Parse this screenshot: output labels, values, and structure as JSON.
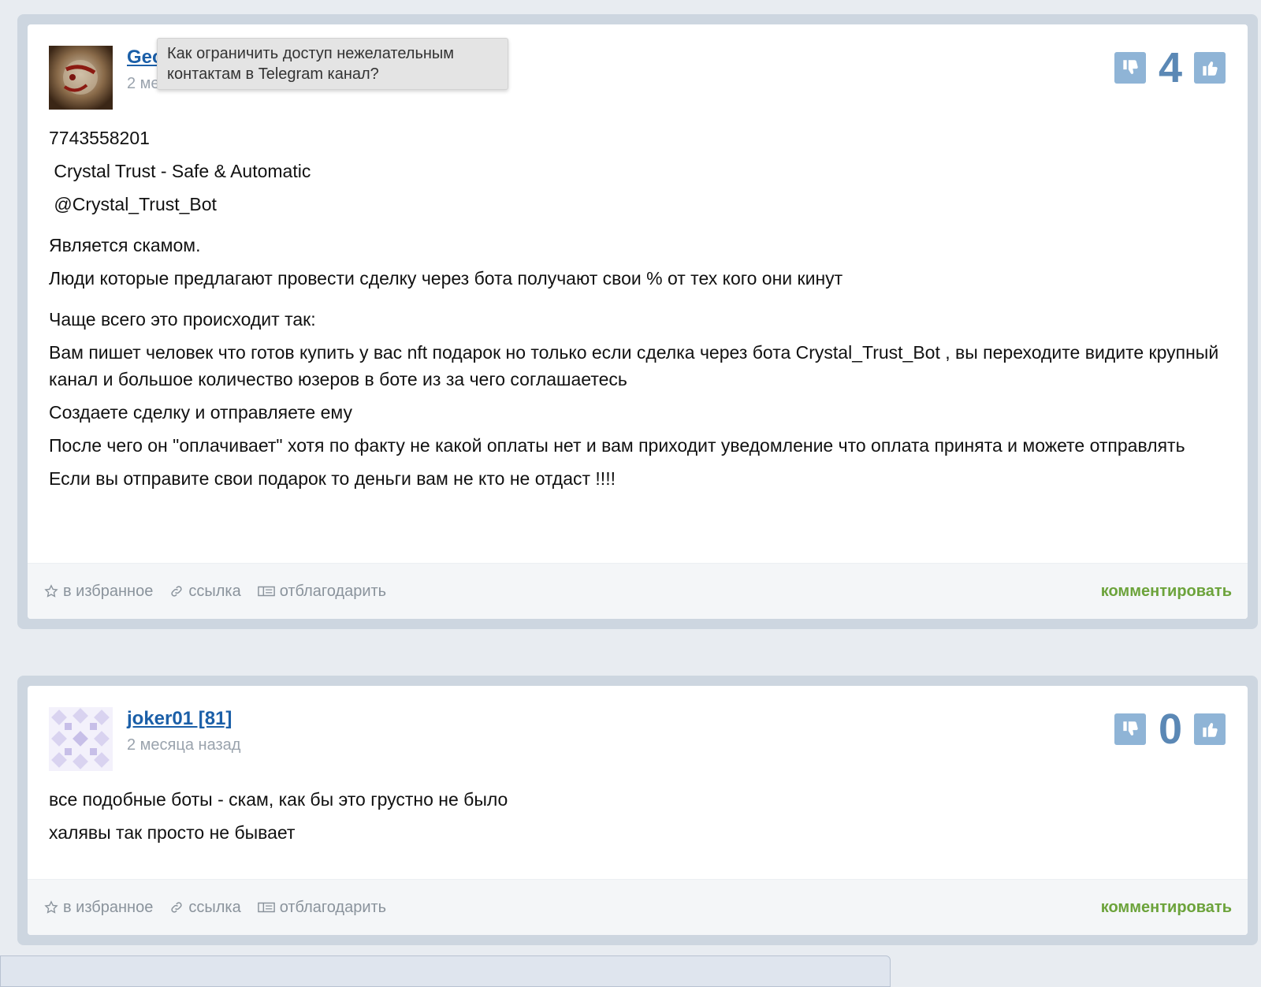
{
  "tooltip": "Как ограничить доступ нежелательным контактам в Telegram канал?",
  "posts": [
    {
      "author": "Geo",
      "date": "2 ме",
      "score": "4",
      "paragraphs": [
        "7743558201",
        " Crystal Trust - Safe & Automatic",
        " @Crystal_Trust_Bot",
        "Является скамом.",
        "Люди которые предлагают провести сделку через бота получают свои % от тех кого они кинут",
        "Чаще всего это происходит так:",
        "Вам пишет человек что готов купить у вас nft подарок но только если сделка через бота Crystal_Trust_Bot , вы переходите видите крупный канал и большое количество юзеров в боте из за чего соглашаетесь",
        "Создаете сделку и отправляете ему",
        "После чего он \"оплачивает\" хотя по факту не какой оплаты нет и вам приходит уведомление что оплата принята и можете отправлять",
        "Если вы отправите свои подарок то деньги вам не кто не отдаст !!!!"
      ]
    },
    {
      "author": "joker01 [81]",
      "date": "2 месяца назад",
      "score": "0",
      "paragraphs": [
        "все подобные боты - скам, как бы это грустно не было",
        "халявы так просто не бывает"
      ]
    }
  ],
  "footer": {
    "favorite": "в избранное",
    "link": "ссылка",
    "thank": "отблагодарить",
    "comment": "комментировать"
  },
  "colors": {
    "author_link": "#1b5fa8",
    "vote_button": "#8fb4d6",
    "score": "#5b88b5",
    "comment_link": "#6ca33b"
  },
  "icons": [
    "thumb-down-icon",
    "thumb-up-icon",
    "star-icon",
    "link-icon",
    "gift-icon"
  ]
}
